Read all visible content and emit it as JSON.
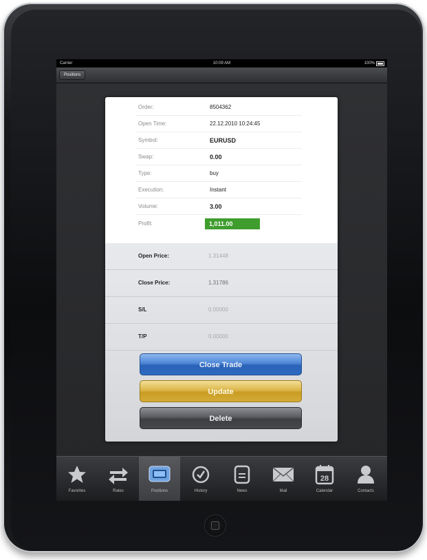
{
  "status_bar": {
    "carrier": "Carrier",
    "time": "10:09 AM",
    "battery": "100%"
  },
  "nav": {
    "back_label": "Positions"
  },
  "details": [
    {
      "label": "Order:",
      "value": "8504362",
      "bold": false
    },
    {
      "label": "Open Time:",
      "value": "22.12.2010 10:24:45",
      "bold": false
    },
    {
      "label": "Symbol:",
      "value": "EURUSD",
      "bold": true
    },
    {
      "label": "Swap:",
      "value": "0.00",
      "bold": true
    },
    {
      "label": "Type:",
      "value": "buy",
      "bold": false
    },
    {
      "label": "Execution:",
      "value": "Instant",
      "bold": false
    },
    {
      "label": "Volume:",
      "value": "3.00",
      "bold": true
    }
  ],
  "profit": {
    "label": "Profit:",
    "value": "1,011.00",
    "color": "#3f9d2e"
  },
  "prices": [
    {
      "label": "Open Price:",
      "value": "1.31448"
    },
    {
      "label": "Close Price:",
      "value": "1.31786"
    },
    {
      "label": "S/L",
      "value": "0.00000"
    },
    {
      "label": "T/P",
      "value": "0.00000"
    }
  ],
  "actions": {
    "close_trade": "Close Trade",
    "update": "Update",
    "delete": "Delete"
  },
  "tabs": [
    {
      "label": "Favorites",
      "icon": "star-icon"
    },
    {
      "label": "Rates",
      "icon": "arrows-exchange-icon"
    },
    {
      "label": "Positions",
      "icon": "positions-icon"
    },
    {
      "label": "History",
      "icon": "clock-icon"
    },
    {
      "label": "News",
      "icon": "document-icon"
    },
    {
      "label": "Mail",
      "icon": "envelope-icon"
    },
    {
      "label": "Calendar",
      "icon": "calendar-icon"
    },
    {
      "label": "Contacts",
      "icon": "person-icon"
    }
  ],
  "calendar_day": "28",
  "active_tab": "Positions",
  "colors": {
    "close_button": "#2d6bc2",
    "update_button": "#d4ab38",
    "delete_button": "#47484b",
    "profit": "#3f9d2e"
  }
}
